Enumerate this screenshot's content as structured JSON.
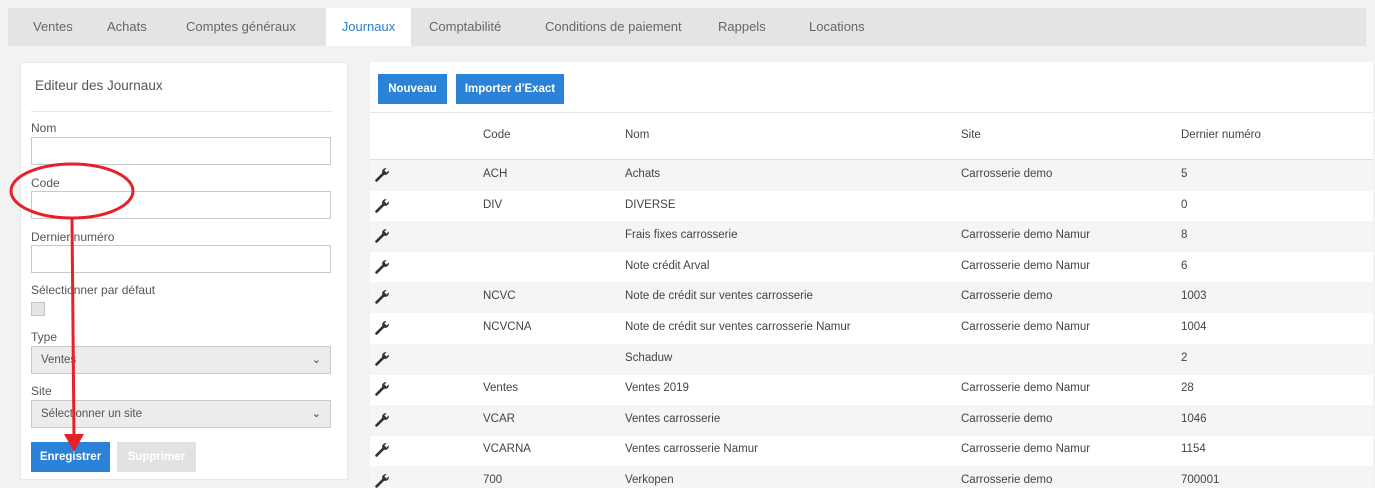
{
  "tabs": [
    {
      "label": "Ventes",
      "active": false
    },
    {
      "label": "Achats",
      "active": false
    },
    {
      "label": "Comptes généraux",
      "active": false
    },
    {
      "label": "Journaux",
      "active": true
    },
    {
      "label": "Comptabilité",
      "active": false
    },
    {
      "label": "Conditions de paiement",
      "active": false
    },
    {
      "label": "Rappels",
      "active": false
    },
    {
      "label": "Locations",
      "active": false
    }
  ],
  "editor": {
    "title": "Editeur des Journaux",
    "nom_label": "Nom",
    "nom_value": "",
    "code_label": "Code",
    "code_value": "",
    "dernier_label": "Dernier numéro",
    "dernier_value": "",
    "defaut_label": "Sélectionner par défaut",
    "defaut_checked": false,
    "type_label": "Type",
    "type_value": "Ventes",
    "site_label": "Site",
    "site_value": "Sélectionner un site",
    "save_label": "Enregistrer",
    "delete_label": "Supprimer"
  },
  "toolbar": {
    "new_label": "Nouveau",
    "import_label": "Importer d'Exact"
  },
  "table": {
    "headers": {
      "code": "Code",
      "nom": "Nom",
      "site": "Site",
      "dernier": "Dernier numéro"
    },
    "rows": [
      {
        "code": "ACH",
        "nom": "Achats",
        "site": "Carrosserie demo",
        "dernier": "5"
      },
      {
        "code": "DIV",
        "nom": "DIVERSE",
        "site": "",
        "dernier": "0"
      },
      {
        "code": "",
        "nom": "Frais fixes carrosserie",
        "site": "Carrosserie demo Namur",
        "dernier": "8"
      },
      {
        "code": "",
        "nom": "Note crédit Arval",
        "site": "Carrosserie demo Namur",
        "dernier": "6"
      },
      {
        "code": "NCVC",
        "nom": "Note de crédit sur ventes carrosserie",
        "site": "Carrosserie demo",
        "dernier": "1003"
      },
      {
        "code": "NCVCNA",
        "nom": "Note de crédit sur ventes carrosserie Namur",
        "site": "Carrosserie demo Namur",
        "dernier": "1004"
      },
      {
        "code": "",
        "nom": "Schaduw",
        "site": "",
        "dernier": "2"
      },
      {
        "code": "Ventes",
        "nom": "Ventes 2019",
        "site": "Carrosserie demo Namur",
        "dernier": "28"
      },
      {
        "code": "VCAR",
        "nom": "Ventes carrosserie",
        "site": "Carrosserie demo",
        "dernier": "1046"
      },
      {
        "code": "VCARNA",
        "nom": "Ventes carrosserie Namur",
        "site": "Carrosserie demo Namur",
        "dernier": "1154"
      },
      {
        "code": "700",
        "nom": "Verkopen",
        "site": "Carrosserie demo",
        "dernier": "700001"
      }
    ]
  },
  "colors": {
    "accent": "#2a83d7",
    "active_tab_text": "#2a7ec8",
    "annotation": "#e8202a"
  }
}
